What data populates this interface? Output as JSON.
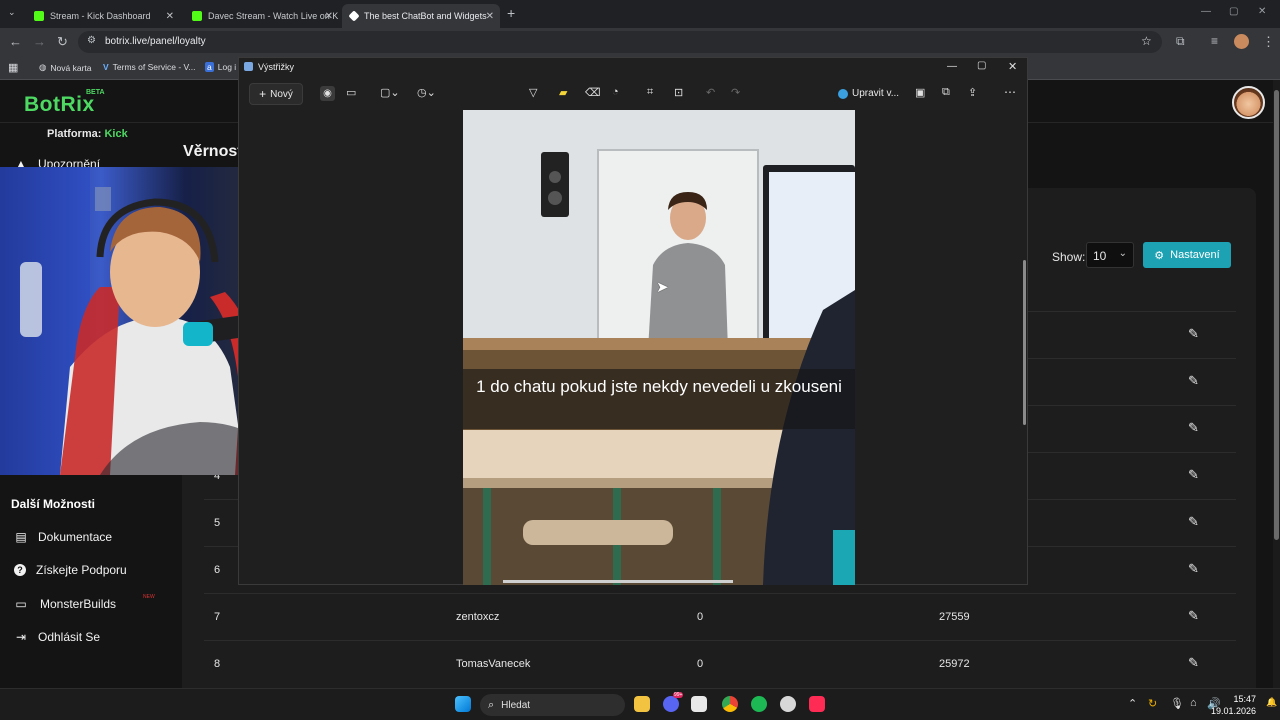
{
  "browser": {
    "tabs": [
      {
        "title": "Stream - Kick Dashboard",
        "favicon_color": "#53fc18",
        "active": false
      },
      {
        "title": "Davec Stream - Watch Live on K",
        "favicon_color": "#53fc18",
        "active": false
      },
      {
        "title": "The best ChatBot and Widgets",
        "favicon_color": "#ffffff",
        "active": true
      }
    ],
    "new_tab": "+",
    "url": "botrix.live/panel/loyalty",
    "bookmarks": [
      {
        "label": "Nová karta",
        "icon": "globe-icon"
      },
      {
        "label": "Terms of Service - V...",
        "icon": "v-logo-icon"
      },
      {
        "label": "Log i",
        "icon": "a-logo-icon"
      }
    ]
  },
  "botrix": {
    "logo": "BotRix",
    "logo_badge": "BETA",
    "platform_label": "Platforma:",
    "platform_value": "Kick",
    "alert_item": "Upozornění",
    "page_title": "Věrnost",
    "more_title": "Další Možnosti",
    "more_items": [
      {
        "label": "Dokumentace",
        "icon": "document-icon"
      },
      {
        "label": "Získejte Podporu",
        "icon": "help-icon"
      },
      {
        "label": "MonsterBuilds",
        "icon": "laptop-icon"
      },
      {
        "label": "Odhlásit Se",
        "icon": "logout-icon"
      }
    ],
    "new_badge": "NEW",
    "show_label": "Show:",
    "show_value": "10",
    "settings_button": "Nastavení",
    "rows": [
      {
        "rank": "",
        "name": "",
        "points": "",
        "watchtime": ""
      },
      {
        "rank": "",
        "name": "",
        "points": "",
        "watchtime": ""
      },
      {
        "rank": "",
        "name": "",
        "points": "",
        "watchtime": ""
      },
      {
        "rank": "4",
        "name": "",
        "points": "",
        "watchtime": ""
      },
      {
        "rank": "5",
        "name": "",
        "points": "",
        "watchtime": ""
      },
      {
        "rank": "6",
        "name": "",
        "points": "",
        "watchtime": ""
      },
      {
        "rank": "7",
        "name": "zentoxcz",
        "points": "0",
        "watchtime": "27559"
      },
      {
        "rank": "8",
        "name": "TomasVanecek",
        "points": "0",
        "watchtime": "25972"
      }
    ],
    "accent": "#4ed963",
    "button_color": "#1ca2b3"
  },
  "snipping_tool": {
    "title": "Výstřižky",
    "new_button": "Nový",
    "edit_in_button": "Upravit v...",
    "caption": "1 do chatu pokud jste nekdy nevedeli u zkouseni"
  },
  "taskbar": {
    "search_placeholder": "Hledat",
    "time": "15:47",
    "date": "19.01.2026",
    "badge_count": "99+"
  }
}
